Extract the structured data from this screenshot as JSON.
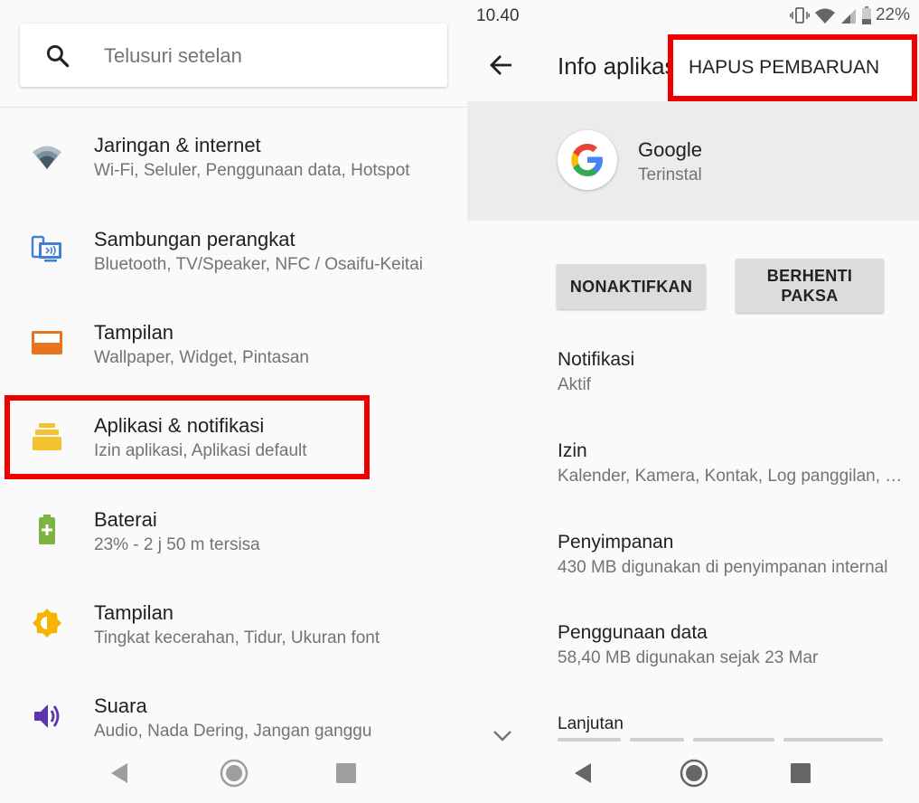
{
  "left": {
    "search": {
      "placeholder": "Telusuri setelan"
    },
    "items": [
      {
        "title": "Jaringan & internet",
        "subtitle": "Wi-Fi, Seluler, Penggunaan data, Hotspot",
        "icon": "wifi-icon",
        "color": "#455a64"
      },
      {
        "title": "Sambungan perangkat",
        "subtitle": "Bluetooth, TV/Speaker, NFC / Osaifu-Keitai",
        "icon": "devices-icon",
        "color": "#3f7fd9"
      },
      {
        "title": "Tampilan",
        "subtitle": "Wallpaper, Widget, Pintasan",
        "icon": "wallpaper-icon",
        "color": "#e8741e"
      },
      {
        "title": "Aplikasi & notifikasi",
        "subtitle": "Izin aplikasi, Aplikasi default",
        "icon": "apps-icon",
        "color": "#f4c430"
      },
      {
        "title": "Baterai",
        "subtitle": "23% - 2 j  50 m tersisa",
        "icon": "battery-icon",
        "color": "#7cb342"
      },
      {
        "title": "Tampilan",
        "subtitle": "Tingkat kecerahan, Tidur, Ukuran font",
        "icon": "brightness-icon",
        "color": "#f4b400"
      },
      {
        "title": "Suara",
        "subtitle": "Audio, Nada Dering, Jangan ganggu",
        "icon": "volume-icon",
        "color": "#5e35b1"
      }
    ],
    "highlight_color": "#ef0000"
  },
  "right": {
    "status": {
      "time": "10.40",
      "battery": "22%"
    },
    "app_bar": {
      "title": "Info aplikasi"
    },
    "overflow_menu": {
      "item": "HAPUS PEMBARUAN"
    },
    "app": {
      "name": "Google",
      "status": "Terinstal"
    },
    "buttons": {
      "disable": "NONAKTIFKAN",
      "force_stop_line1": "BERHENTI",
      "force_stop_line2": "PAKSA"
    },
    "info": [
      {
        "title": "Notifikasi",
        "subtitle": "Aktif"
      },
      {
        "title": "Izin",
        "subtitle": "Kalender, Kamera, Kontak, Log panggilan, …"
      },
      {
        "title": "Penyimpanan",
        "subtitle": "430 MB digunakan di penyimpanan internal"
      },
      {
        "title": "Penggunaan data",
        "subtitle": "58,40 MB digunakan sejak 23 Mar"
      },
      {
        "title": "Lanjutan",
        "subtitle": ""
      }
    ]
  },
  "nav_icons": [
    "back-icon",
    "home-icon",
    "recents-icon"
  ]
}
